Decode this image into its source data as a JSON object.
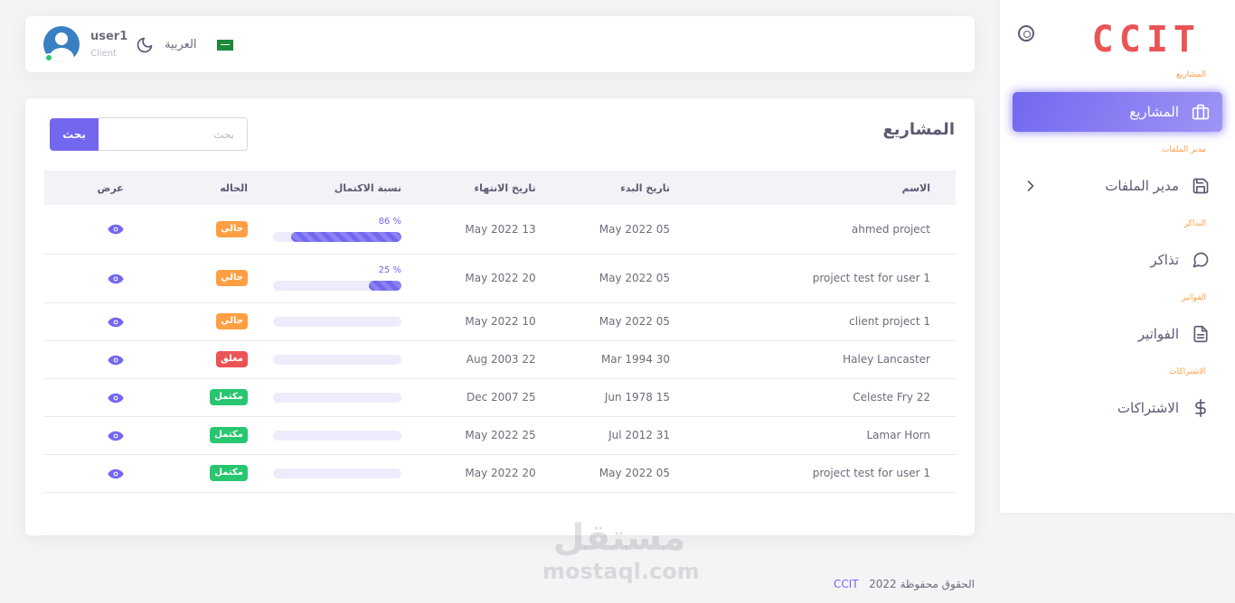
{
  "navbar": {
    "user_name": "user1",
    "user_role": "Client",
    "language": "العربية"
  },
  "sidebar": {
    "logo": "CCIT",
    "sections": [
      {
        "header": "المشاريع",
        "item": "المشاريع",
        "icon": "briefcase-icon",
        "active": true
      },
      {
        "header": "مدير الملفات",
        "item": "مدير الملفات",
        "icon": "save-icon",
        "active": false
      },
      {
        "header": "التذاكر",
        "item": "تذاكر",
        "icon": "message-circle-icon",
        "active": false
      },
      {
        "header": "الفواتير",
        "item": "الفواتير",
        "icon": "file-text-icon",
        "active": false
      },
      {
        "header": "الاشتراكات",
        "item": "الاشتراكات",
        "icon": "dollar-icon",
        "active": false
      }
    ]
  },
  "main": {
    "title": "المشاريع",
    "search": {
      "button": "بحث",
      "placeholder": "بحث",
      "value": ""
    },
    "columns": [
      "الاسم",
      "تاريخ البدء",
      "تاريخ الانتهاء",
      "نسبة الاكتمال",
      "الحاله",
      "عرض"
    ],
    "rows": [
      {
        "name": "ahmed project",
        "start": "05 May 2022",
        "end": "13 May 2022",
        "progress": 86,
        "progress_label": "86 %",
        "status": "حالي",
        "status_type": "current"
      },
      {
        "name": "project test for user 1",
        "start": "05 May 2022",
        "end": "20 May 2022",
        "progress": 25,
        "progress_label": "25 %",
        "status": "حالي",
        "status_type": "current"
      },
      {
        "name": "client project 1",
        "start": "05 May 2022",
        "end": "10 May 2022",
        "progress": 0,
        "progress_label": "",
        "status": "حالي",
        "status_type": "current"
      },
      {
        "name": "Haley Lancaster",
        "start": "30 Mar 1994",
        "end": "22 Aug 2003",
        "progress": 0,
        "progress_label": "",
        "status": "مغلق",
        "status_type": "closed"
      },
      {
        "name": "Celeste Fry 22",
        "start": "15 Jun 1978",
        "end": "25 Dec 2007",
        "progress": 0,
        "progress_label": "",
        "status": "مكتمل",
        "status_type": "complete"
      },
      {
        "name": "Lamar Horn",
        "start": "31 Jul 2012",
        "end": "25 May 2022",
        "progress": 0,
        "progress_label": "",
        "status": "مكتمل",
        "status_type": "complete"
      },
      {
        "name": "project test for user 1",
        "start": "05 May 2022",
        "end": "20 May 2022",
        "progress": 0,
        "progress_label": "",
        "status": "مكتمل",
        "status_type": "complete"
      }
    ]
  },
  "footer": {
    "year": "2022",
    "brand": "CCIT",
    "text": "الحقوق محفوظة"
  },
  "watermark": {
    "arabic": "مستقل",
    "latin": "mostaql.com"
  },
  "colors": {
    "primary": "#7367f0",
    "warning": "#ff9f43",
    "danger": "#ea5455",
    "success": "#28c76f"
  }
}
